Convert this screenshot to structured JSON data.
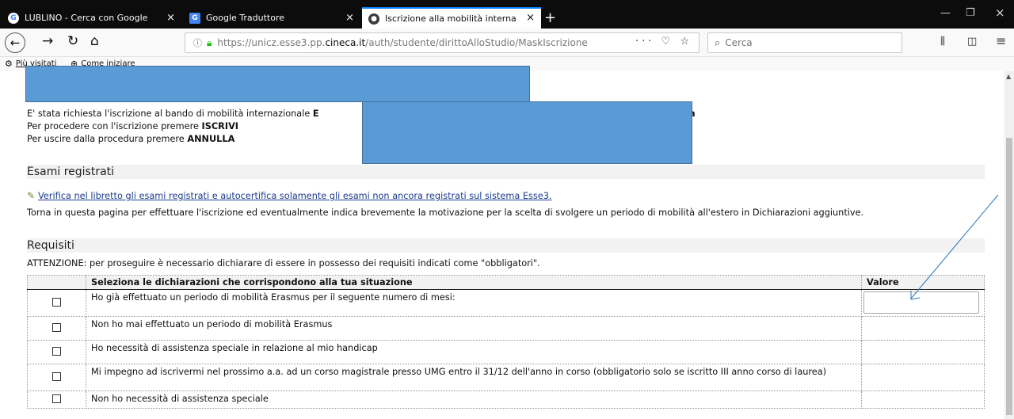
{
  "tabs": [
    {
      "title": "LUBLINO - Cerca con Google",
      "icon": "google-icon",
      "close": "×"
    },
    {
      "title": "Google Traduttore",
      "icon": "translate-icon",
      "close": "×"
    },
    {
      "title": "Iscrizione alla mobilità interna",
      "icon": "esse3-icon",
      "close": "×"
    }
  ],
  "new_tab_label": "+",
  "window_controls": {
    "minimize": "—",
    "restore": "❐",
    "close": "×"
  },
  "toolbar": {
    "back": "←",
    "forward": "→",
    "reload": "↻",
    "home": "⌂",
    "url_info": "ⓘ",
    "url_prefix": "https://unicz.esse3.pp.",
    "url_domain": "cineca.it",
    "url_path": "/auth/studente/dirittoAlloStudio/MaskIscrizione",
    "page_actions": "··· ♡ ☆",
    "search_placeholder": "Cerca",
    "library": "⫼",
    "sidebar": "◫",
    "menu": "≡"
  },
  "bookmarks": [
    {
      "label": "Più visitati",
      "icon": "gear-icon"
    },
    {
      "label": "Come iniziare",
      "icon": "globe-icon"
    }
  ],
  "intro": {
    "line1_prefix": "E' stata richiesta l'iscrizione al bando di mobilità  internazionale ",
    "line1_bold_start": "E",
    "line1_bold_end": "gia",
    "line2_prefix": "Per procedere con l'iscrizione premere ",
    "line2_bold": "ISCRIVI",
    "line3_prefix": "Per uscire dalla procedura premere ",
    "line3_bold": "ANNULLA"
  },
  "esami": {
    "heading": "Esami registrati",
    "link": "Verifica nel libretto gli esami registrati e autocertifica solamente gli esami non ancora registrati sul sistema Esse3.",
    "note": "Torna in questa pagina per effettuare l'iscrizione ed eventualmente indica brevemente la motivazione per la scelta di svolgere un periodo di mobilità all'estero in Dichiarazioni aggiuntive."
  },
  "requisiti": {
    "heading": "Requisiti",
    "warning": "ATTENZIONE: per proseguire è necessario dichiarare di essere in possesso dei requisiti indicati come \"obbligatori\".",
    "col_select": "Seleziona le dichiarazioni che corrispondono alla tua situazione",
    "col_value": "Valore",
    "rows": [
      {
        "text": "Ho già effettuato un periodo di mobilità Erasmus per il seguente numero di mesi:",
        "has_input": true
      },
      {
        "text": "Non ho mai effettuato un periodo di mobilità Erasmus",
        "has_input": false
      },
      {
        "text": "Ho necessità di assistenza speciale in relazione al mio handicap",
        "has_input": false
      },
      {
        "text": "Mi impegno ad iscrivermi nel prossimo a.a. ad un corso magistrale presso UMG entro il 31/12 dell'anno in corso (obbligatorio solo se iscritto III anno corso di laurea)",
        "has_input": false
      },
      {
        "text": "Non ho necessità di assistenza speciale",
        "has_input": false
      }
    ]
  },
  "colors": {
    "tabbar": "#0c0c0d",
    "accent": "#0a84ff",
    "redaction": "#5b9bd5",
    "annotation_arrow": "#2e75b6"
  }
}
